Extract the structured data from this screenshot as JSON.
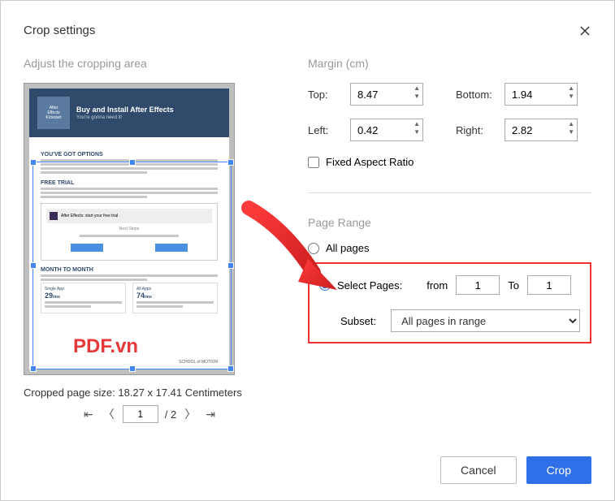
{
  "dialog": {
    "title": "Crop settings"
  },
  "left": {
    "section_title": "Adjust the cropping area",
    "preview": {
      "banner_title": "Buy and Install After Effects",
      "banner_sub": "You're gonna need it!",
      "banner_tag1": "After",
      "banner_tag2": "Effects",
      "banner_tag3": "Kickstart",
      "heading1": "YOU'VE GOT OPTIONS",
      "heading2": "FREE TRIAL",
      "trial_box": "After Effects: start your free trial",
      "trial_sub": "Next Steps",
      "heading3": "MONTH TO MONTH",
      "card1_label": "Single App",
      "card1_price": "29",
      "card2_label": "All Apps",
      "card2_price": "74",
      "footer_text": "SCHOOL of MOTION"
    },
    "watermark": "PDF.vn",
    "cropped_size": "Cropped page size: 18.27 x 17.41 Centimeters",
    "pager": {
      "page_value": "1",
      "page_total": "/ 2"
    }
  },
  "right": {
    "margin_title": "Margin (cm)",
    "top_label": "Top:",
    "top_value": "8.47",
    "bottom_label": "Bottom:",
    "bottom_value": "1.94",
    "left_label": "Left:",
    "left_value": "0.42",
    "right_label": "Right:",
    "right_value": "2.82",
    "fixed_aspect_label": "Fixed Aspect Ratio",
    "range_title": "Page Range",
    "all_pages_label": "All pages",
    "select_pages_label": "Select Pages:",
    "from_label": "from",
    "from_value": "1",
    "to_label": "To",
    "to_value": "1",
    "subset_label": "Subset:",
    "subset_value": "All pages in range"
  },
  "buttons": {
    "cancel": "Cancel",
    "crop": "Crop"
  }
}
